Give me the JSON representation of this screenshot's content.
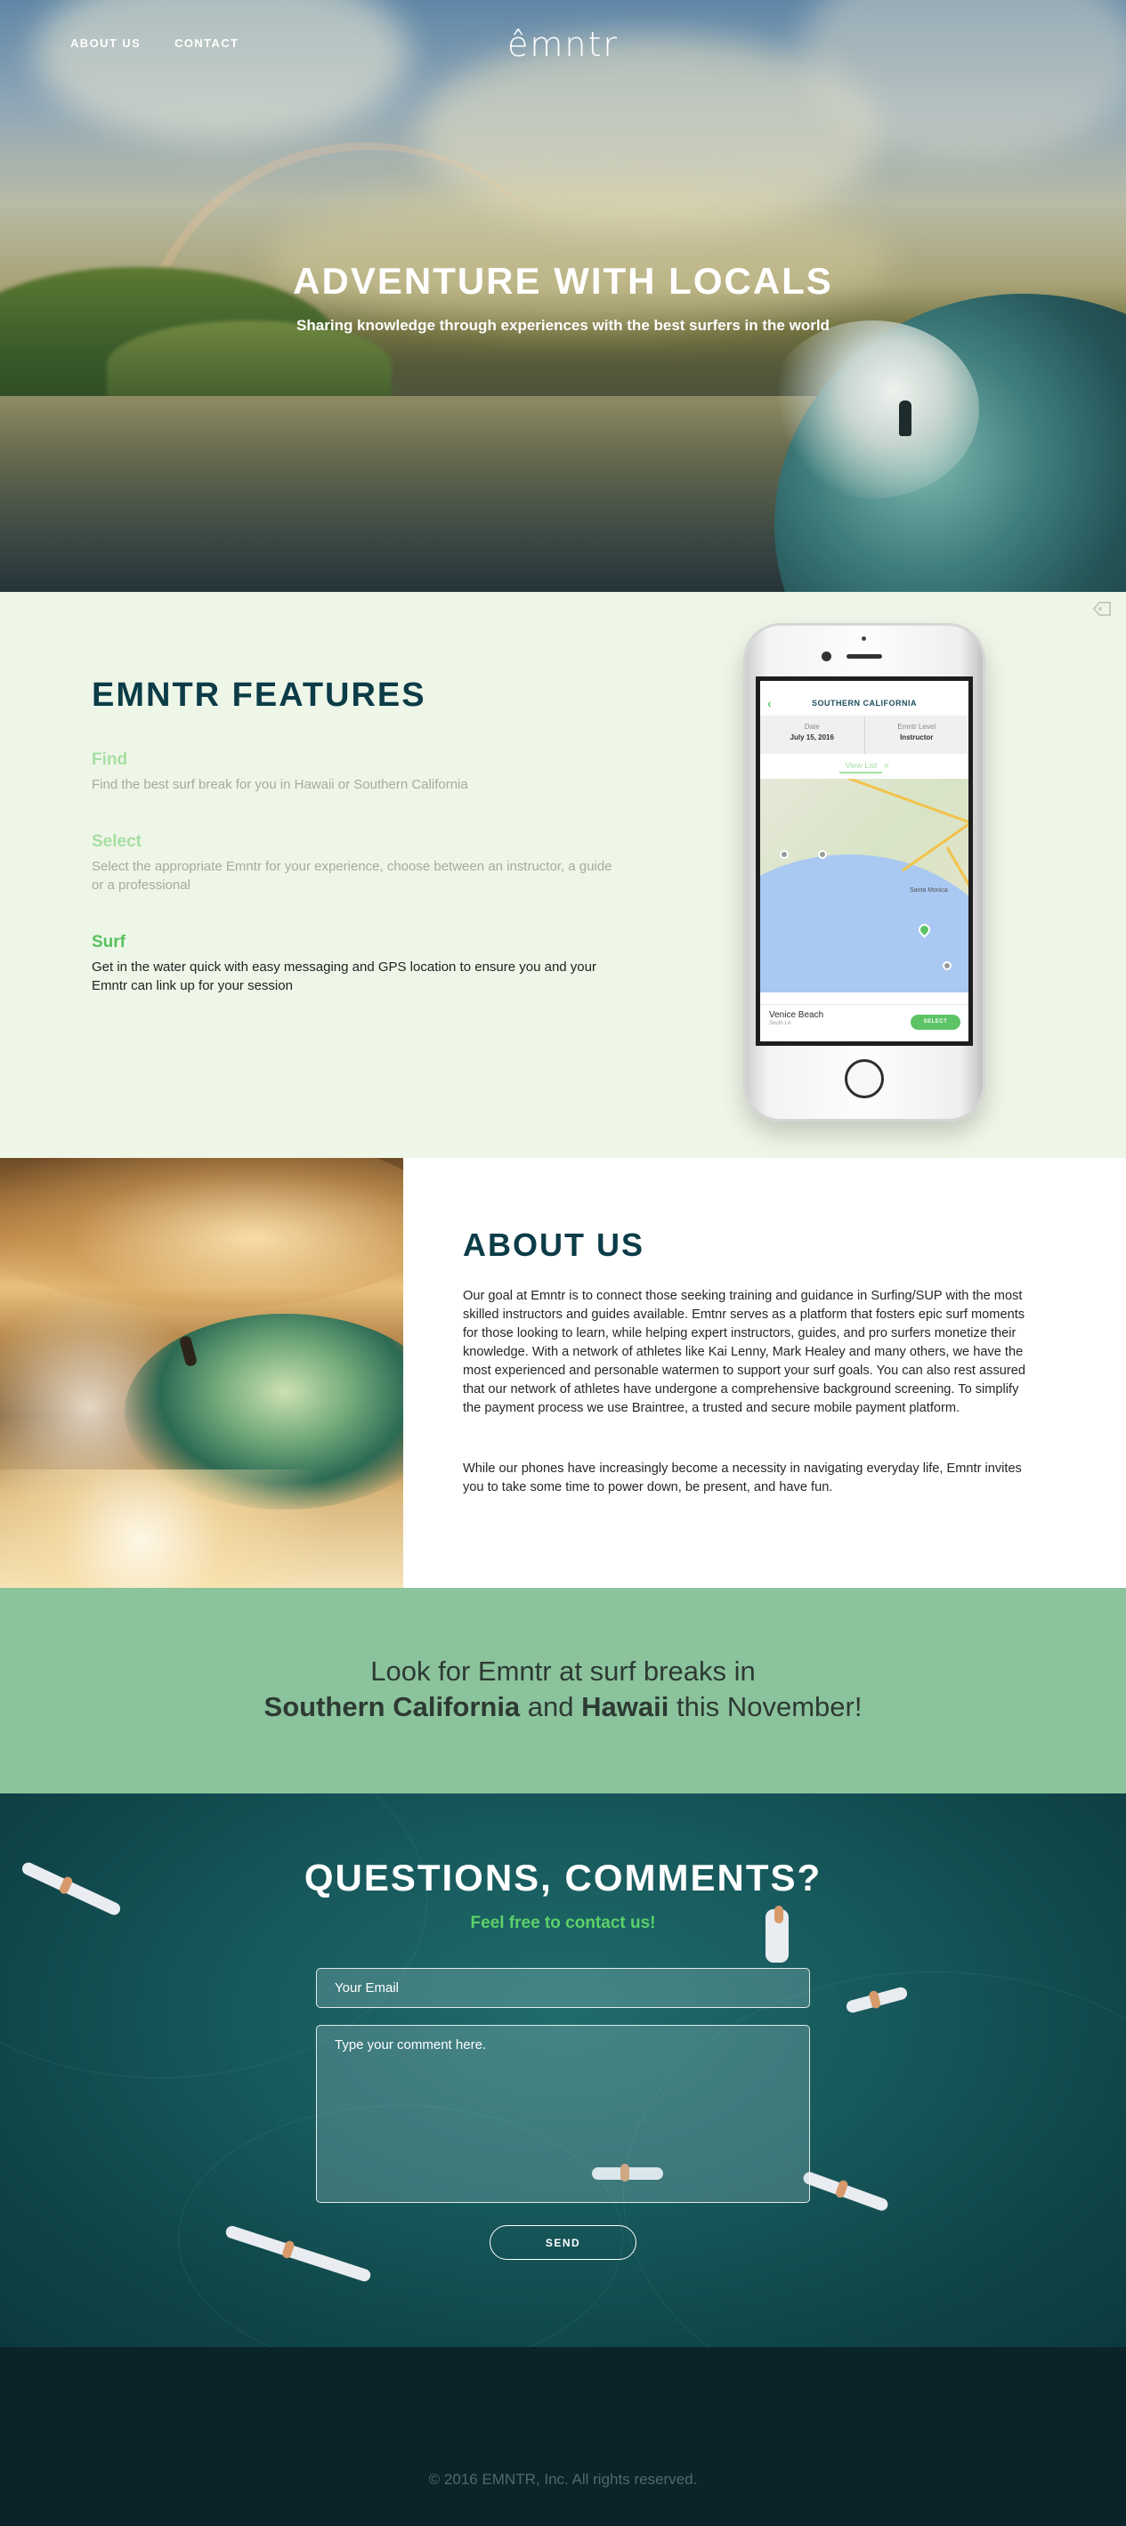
{
  "nav": {
    "about_label": "ABOUT US",
    "contact_label": "CONTACT",
    "logo_text": "êmntr"
  },
  "hero": {
    "title": "ADVENTURE WITH LOCALS",
    "subtitle": "Sharing knowledge through experiences with the best surfers in the world"
  },
  "features": {
    "title": "EMNTR FEATURES",
    "items": [
      {
        "name": "Find",
        "description": "Find the best surf break for you in Hawaii or Southern California"
      },
      {
        "name": "Select",
        "description": "Select the appropriate Emntr for your experience, choose between an instructor, a guide or a professional"
      },
      {
        "name": "Surf",
        "description": "Get in the water quick with easy messaging and GPS location to ensure you and your Emntr can link up for your session"
      }
    ]
  },
  "phone": {
    "header_title": "SOUTHERN CALIFORNIA",
    "date_label": "Date",
    "date_value": "July 15, 2016",
    "level_label": "Emntr Level",
    "level_value": "Instructor",
    "view_list_label": "View List",
    "map_label": "Santa Monica",
    "location_name": "Venice Beach",
    "location_sub": "South LA",
    "select_label": "SELECT"
  },
  "about": {
    "title": "ABOUT US",
    "paragraph_1": "Our goal at Emntr is to connect those seeking training and guidance in Surfing/SUP with the most skilled instructors and guides available. Emtnr serves as a platform that fosters epic surf moments for those looking to learn, while helping expert instructors, guides, and pro surfers monetize their knowledge. With a network of athletes like Kai Lenny, Mark Healey and many others, we have the most experienced and personable watermen to support your surf goals. You can also rest assured that our network of athletes have undergone a comprehensive background screening. To simplify the payment process we use Braintree, a trusted and secure mobile payment platform.",
    "paragraph_2": "While our phones have increasingly become a necessity in navigating everyday life, Emntr invites you to take some time to power down, be present, and have fun."
  },
  "banner": {
    "line_1": "Look for Emntr at surf breaks in",
    "place_1": "Southern California",
    "joiner": " and ",
    "place_2": "Hawaii",
    "suffix": " this November!"
  },
  "contact": {
    "title": "QUESTIONS, COMMENTS?",
    "subtitle": "Feel free to contact us!",
    "email_placeholder": "Your Email",
    "comment_placeholder": "Type your comment here.",
    "send_label": "SEND"
  },
  "footer": {
    "copyright": "© 2016 EMNTR, Inc. All rights reserved."
  },
  "colors": {
    "dark_teal": "#0b3c47",
    "accent_green": "#5cc464",
    "light_green": "#a7dea3",
    "features_bg": "#eef6e7",
    "banner_bg": "#8bc39c",
    "footer_bg": "#0a2428"
  },
  "icons": {
    "tag": "tag-icon",
    "back": "chevron-left-icon",
    "list": "list-icon"
  }
}
